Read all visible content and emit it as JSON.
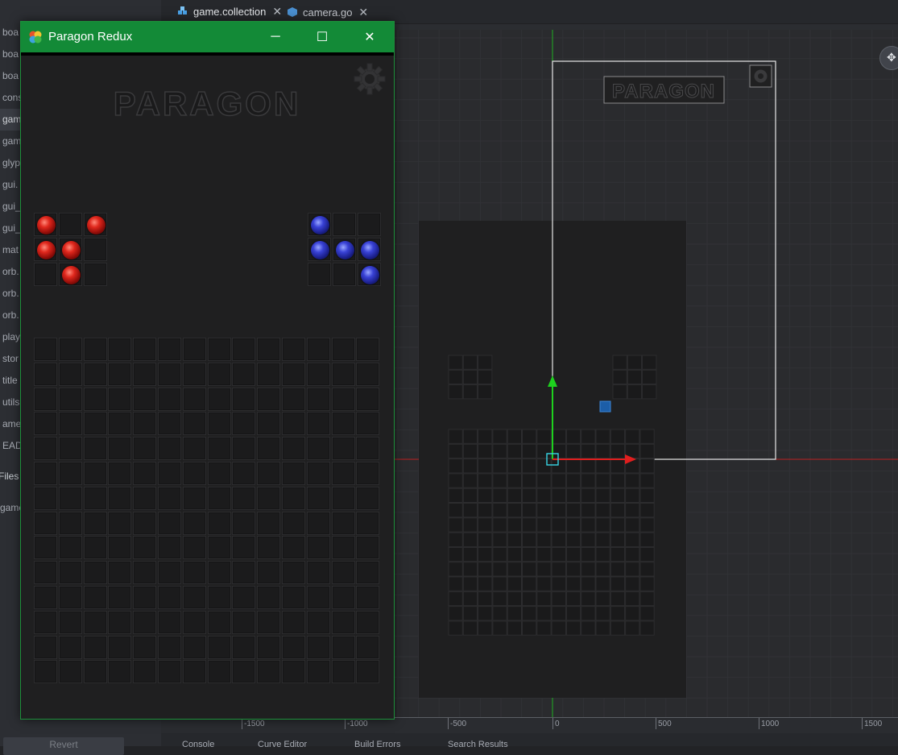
{
  "editor": {
    "tabs": [
      {
        "label": "game.collection",
        "icon": "collection-icon",
        "active": true
      },
      {
        "label": "camera.go",
        "icon": "game-object-icon",
        "active": false
      }
    ],
    "assets": [
      "boa",
      "boa",
      "boa",
      "cons",
      "gam",
      "gam",
      "glyp",
      "gui.",
      "gui_",
      "gui_",
      "mat",
      "orb.",
      "orb.",
      "orb.",
      "play",
      "stor",
      "title",
      "utils",
      "ame.",
      "EADM"
    ],
    "selected_asset_index": 4,
    "files_label": "Files",
    "files_item": "game",
    "revert_label": "Revert",
    "ruler_labels": [
      "-1500",
      "-1000",
      "-500",
      "0",
      "500",
      "1000",
      "1500"
    ],
    "bottom_tabs": [
      "Console",
      "Curve Editor",
      "Build Errors",
      "Search Results"
    ],
    "scene_logo": "PARAGON"
  },
  "game_window": {
    "title": "Paragon Redux",
    "minimize_label": "─",
    "maximize_label": "☐",
    "close_label": "✕",
    "logo": "PARAGON",
    "red_tray": [
      [
        "red",
        "",
        "red"
      ],
      [
        "red",
        "red",
        ""
      ],
      [
        "",
        "red",
        ""
      ]
    ],
    "blue_tray": [
      [
        "blue",
        "",
        ""
      ],
      [
        "blue",
        "blue",
        "blue"
      ],
      [
        "",
        "",
        "blue"
      ]
    ],
    "board": {
      "rows": 14,
      "cols": 14
    }
  },
  "colors": {
    "titlebar": "#138a37",
    "accent_tab": "#3d8fd6",
    "axis_x": "#e01e1e",
    "axis_y": "#1ed11e"
  }
}
